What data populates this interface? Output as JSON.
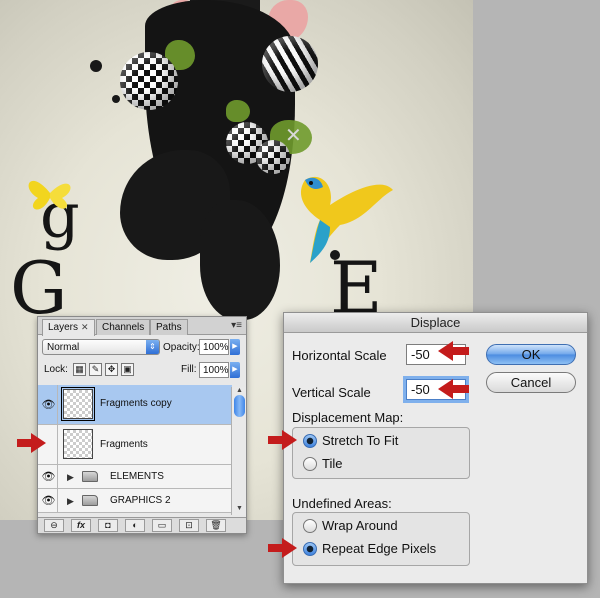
{
  "layers_panel": {
    "tabs": [
      {
        "label": "Layers",
        "close": "✕"
      },
      {
        "label": "Channels"
      },
      {
        "label": "Paths"
      }
    ],
    "panel_menu": "▾≡",
    "blend_mode": "Normal",
    "opacity_label": "Opacity:",
    "opacity_value": "100%",
    "lock_label": "Lock:",
    "fill_label": "Fill:",
    "fill_value": "100%",
    "layers": [
      {
        "name": "Fragments copy",
        "visible": true,
        "selected": true,
        "type": "layer"
      },
      {
        "name": "Fragments",
        "visible": false,
        "selected": false,
        "type": "layer"
      },
      {
        "name": "ELEMENTS",
        "visible": true,
        "selected": false,
        "type": "group"
      },
      {
        "name": "GRAPHICS 2",
        "visible": true,
        "selected": false,
        "type": "group"
      }
    ],
    "footer_buttons": [
      "link-icon",
      "fx-icon",
      "mask-icon",
      "adjustment-icon",
      "folder-icon",
      "new-layer-icon",
      "trash-icon"
    ],
    "footer_glyphs": [
      "⊖",
      "fx",
      "◘",
      "◐",
      "▭",
      "⊡",
      "🗑"
    ]
  },
  "displace_dialog": {
    "title": "Displace",
    "horizontal_scale_label": "Horizontal Scale",
    "horizontal_scale_value": "-50",
    "vertical_scale_label": "Vertical Scale",
    "vertical_scale_value": "-50",
    "ok_label": "OK",
    "cancel_label": "Cancel",
    "displacement_map_label": "Displacement Map:",
    "displacement_map_options": [
      {
        "label": "Stretch To Fit",
        "selected": true
      },
      {
        "label": "Tile",
        "selected": false
      }
    ],
    "undefined_areas_label": "Undefined Areas:",
    "undefined_areas_options": [
      {
        "label": "Wrap Around",
        "selected": false
      },
      {
        "label": "Repeat Edge Pixels",
        "selected": true
      }
    ]
  },
  "colors": {
    "annotation_arrow": "#c41c1c",
    "selection_blue": "#a8c8f0",
    "default_button": "#4b8be0"
  }
}
